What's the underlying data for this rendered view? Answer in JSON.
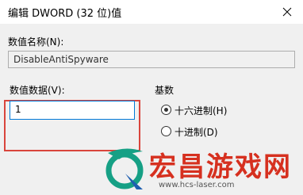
{
  "window": {
    "title": "编辑 DWORD (32 位)值",
    "close_icon": "close-icon"
  },
  "form": {
    "value_name_label": "数值名称(N):",
    "value_name": "DisableAntiSpyware",
    "value_data_label": "数值数据(V):",
    "value_data": "1",
    "base_label": "基数",
    "base_options": [
      {
        "label": "十六进制(H)",
        "selected": true
      },
      {
        "label": "十进制(D)",
        "selected": false
      }
    ]
  },
  "colors": {
    "highlight_border": "#d9453c",
    "watermark_red": "#d6301f",
    "focus_border": "#0078d7"
  },
  "watermark": {
    "text": "宏昌游戏网",
    "url": "www.hcs-laser.com"
  }
}
